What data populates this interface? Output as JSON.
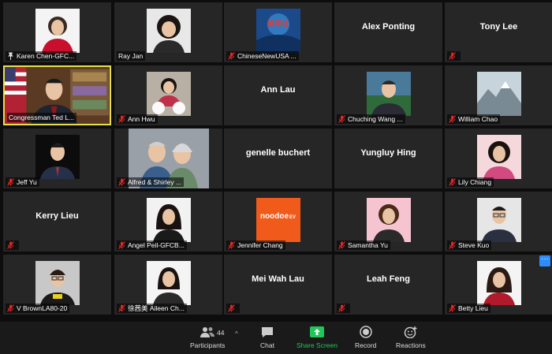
{
  "tiles": [
    {
      "name": "Karen Chen-GFC...",
      "type": "photo",
      "icon": "pin",
      "photo": "woman-red",
      "active": false
    },
    {
      "name": "Ray Jan",
      "type": "photo",
      "icon": "none",
      "photo": "woman-dark",
      "active": false
    },
    {
      "name": "ChineseNewUSA ...",
      "type": "photo",
      "icon": "mic-muted",
      "photo": "logo-blue",
      "active": false
    },
    {
      "name": "Alex Ponting",
      "type": "text",
      "icon": "none",
      "active": false
    },
    {
      "name": "Tony Lee",
      "type": "text",
      "icon": "mic-muted",
      "active": false
    },
    {
      "name": "Congressman Ted L...",
      "type": "photo",
      "icon": "none",
      "photo": "office-flag",
      "active": true
    },
    {
      "name": "Ann Hwu",
      "type": "photo",
      "icon": "mic-muted",
      "photo": "woman-dogs",
      "active": false
    },
    {
      "name": "Ann Lau",
      "type": "text",
      "icon": "none",
      "active": false
    },
    {
      "name": "Chuching Wang ...",
      "type": "photo",
      "icon": "mic-muted",
      "photo": "man-suit",
      "active": false
    },
    {
      "name": "William Chao",
      "type": "photo",
      "icon": "mic-muted",
      "photo": "mountain",
      "active": false
    },
    {
      "name": "Jeff Yu",
      "type": "photo",
      "icon": "mic-muted",
      "photo": "man-dark",
      "active": false
    },
    {
      "name": "Alfred & Shirley ...",
      "type": "photo",
      "icon": "mic-muted",
      "photo": "couple",
      "active": false
    },
    {
      "name": "genelle buchert",
      "type": "text",
      "icon": "none",
      "active": false
    },
    {
      "name": "Yungluy Hing",
      "type": "text",
      "icon": "none",
      "active": false
    },
    {
      "name": "Lily Chiang",
      "type": "photo",
      "icon": "mic-muted",
      "photo": "woman-pink",
      "active": false
    },
    {
      "name": "Kerry Lieu",
      "type": "text",
      "icon": "mic-muted",
      "active": false
    },
    {
      "name": "Angel Peil-GFCB...",
      "type": "photo",
      "icon": "mic-muted",
      "photo": "woman-black",
      "active": false
    },
    {
      "name": "Jennifer Chang",
      "type": "photo",
      "icon": "mic-muted",
      "photo": "logo-orange",
      "active": false
    },
    {
      "name": "Samantha Yu",
      "type": "photo",
      "icon": "mic-muted",
      "photo": "woman-pink2",
      "active": false
    },
    {
      "name": "Steve Kuo",
      "type": "photo",
      "icon": "mic-muted",
      "photo": "man-glasses",
      "active": false
    },
    {
      "name": "V BrownLA80-20",
      "type": "photo",
      "icon": "mic-muted",
      "photo": "woman-glasses",
      "active": false
    },
    {
      "name": "徐茜美 Aileen Ch...",
      "type": "photo",
      "icon": "mic-muted",
      "photo": "woman-smile",
      "active": false
    },
    {
      "name": "Mei Wah Lau",
      "type": "text",
      "icon": "mic-muted",
      "active": false
    },
    {
      "name": "Leah Feng",
      "type": "text",
      "icon": "mic-muted",
      "active": false
    },
    {
      "name": "Betty Lieu",
      "type": "photo",
      "icon": "mic-muted",
      "photo": "woman-red2",
      "active": false
    }
  ],
  "logo_orange_text": "noodoe",
  "logo_orange_sub": "EV",
  "logo_blue_text": "美华社",
  "more_button": "···",
  "toolbar": {
    "participants_label": "Participants",
    "participants_count": "44",
    "chat_label": "Chat",
    "share_label": "Share Screen",
    "record_label": "Record",
    "reactions_label": "Reactions"
  },
  "colors": {
    "tile_bg": "#262626",
    "active_border": "#e8e04b",
    "muted_red": "#e02828",
    "share_green": "#20c659",
    "more_blue": "#2d8cff"
  }
}
